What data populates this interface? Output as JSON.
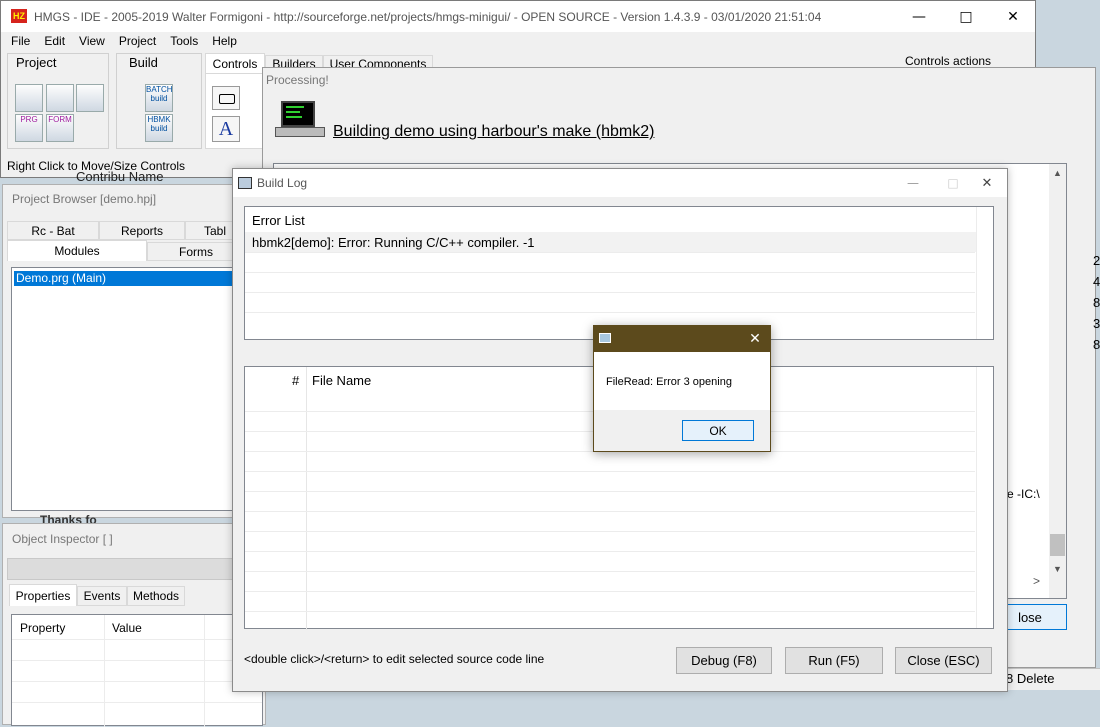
{
  "main": {
    "title": "HMGS - IDE - 2005-2019 Walter Formigoni - http://sourceforge.net/projects/hmgs-minigui/ - OPEN SOURCE - Version 1.4.3.9 - 03/01/2020 21:51:04",
    "logo_text": "HZ",
    "menu": [
      "File",
      "Edit",
      "View",
      "Project",
      "Tools",
      "Help"
    ],
    "groups": {
      "project": "Project",
      "build": "Build"
    },
    "tabs": [
      "Controls",
      "Builders",
      "User Components"
    ],
    "controls_actions": "Controls actions",
    "status_hint": "Right Click to Move/Size Controls",
    "overlap_text": "Contribu Name",
    "icons": {
      "batch_build": "BATCH build",
      "hbmk_build": "HBMK build",
      "prg": "PRG",
      "form": "FORM"
    }
  },
  "project_browser": {
    "title": "Project Browser [demo.hpj]",
    "tabs_row1": [
      "Rc - Bat",
      "Reports",
      "Tabl"
    ],
    "tabs_row2": [
      "Modules",
      "Forms"
    ],
    "items": [
      "Demo.prg (Main)"
    ]
  },
  "object_inspector": {
    "title": "Object Inspector [ ]",
    "tabs": [
      "Properties",
      "Events",
      "Methods"
    ],
    "columns": [
      "Property",
      "Value"
    ],
    "overlap_text": "Thanks fo"
  },
  "processing": {
    "title": "Processing!",
    "heading": "Building demo using harbour's make (hbmk2)",
    "right_digits": [
      "2",
      "4",
      "8",
      "3",
      "8"
    ],
    "cut_text": "e -IC:\\",
    "close_label": "lose",
    "status_text": "8 Delete"
  },
  "build_log": {
    "title": "Build Log",
    "error_header": "Error List",
    "errors": [
      "hbmk2[demo]: Error: Running C/C++ compiler. -1"
    ],
    "columns": [
      "#",
      "File Name"
    ],
    "hint": "<double click>/<return> to edit selected source code line",
    "buttons": {
      "debug": "Debug (F8)",
      "run": "Run (F5)",
      "close": "Close (ESC)"
    }
  },
  "dialog": {
    "message": "FileRead: Error 3 opening",
    "ok": "OK"
  },
  "colors": {
    "selection": "#0078d7",
    "dialog_title": "#5c4a1c",
    "accent_blue": "#0078d7"
  }
}
